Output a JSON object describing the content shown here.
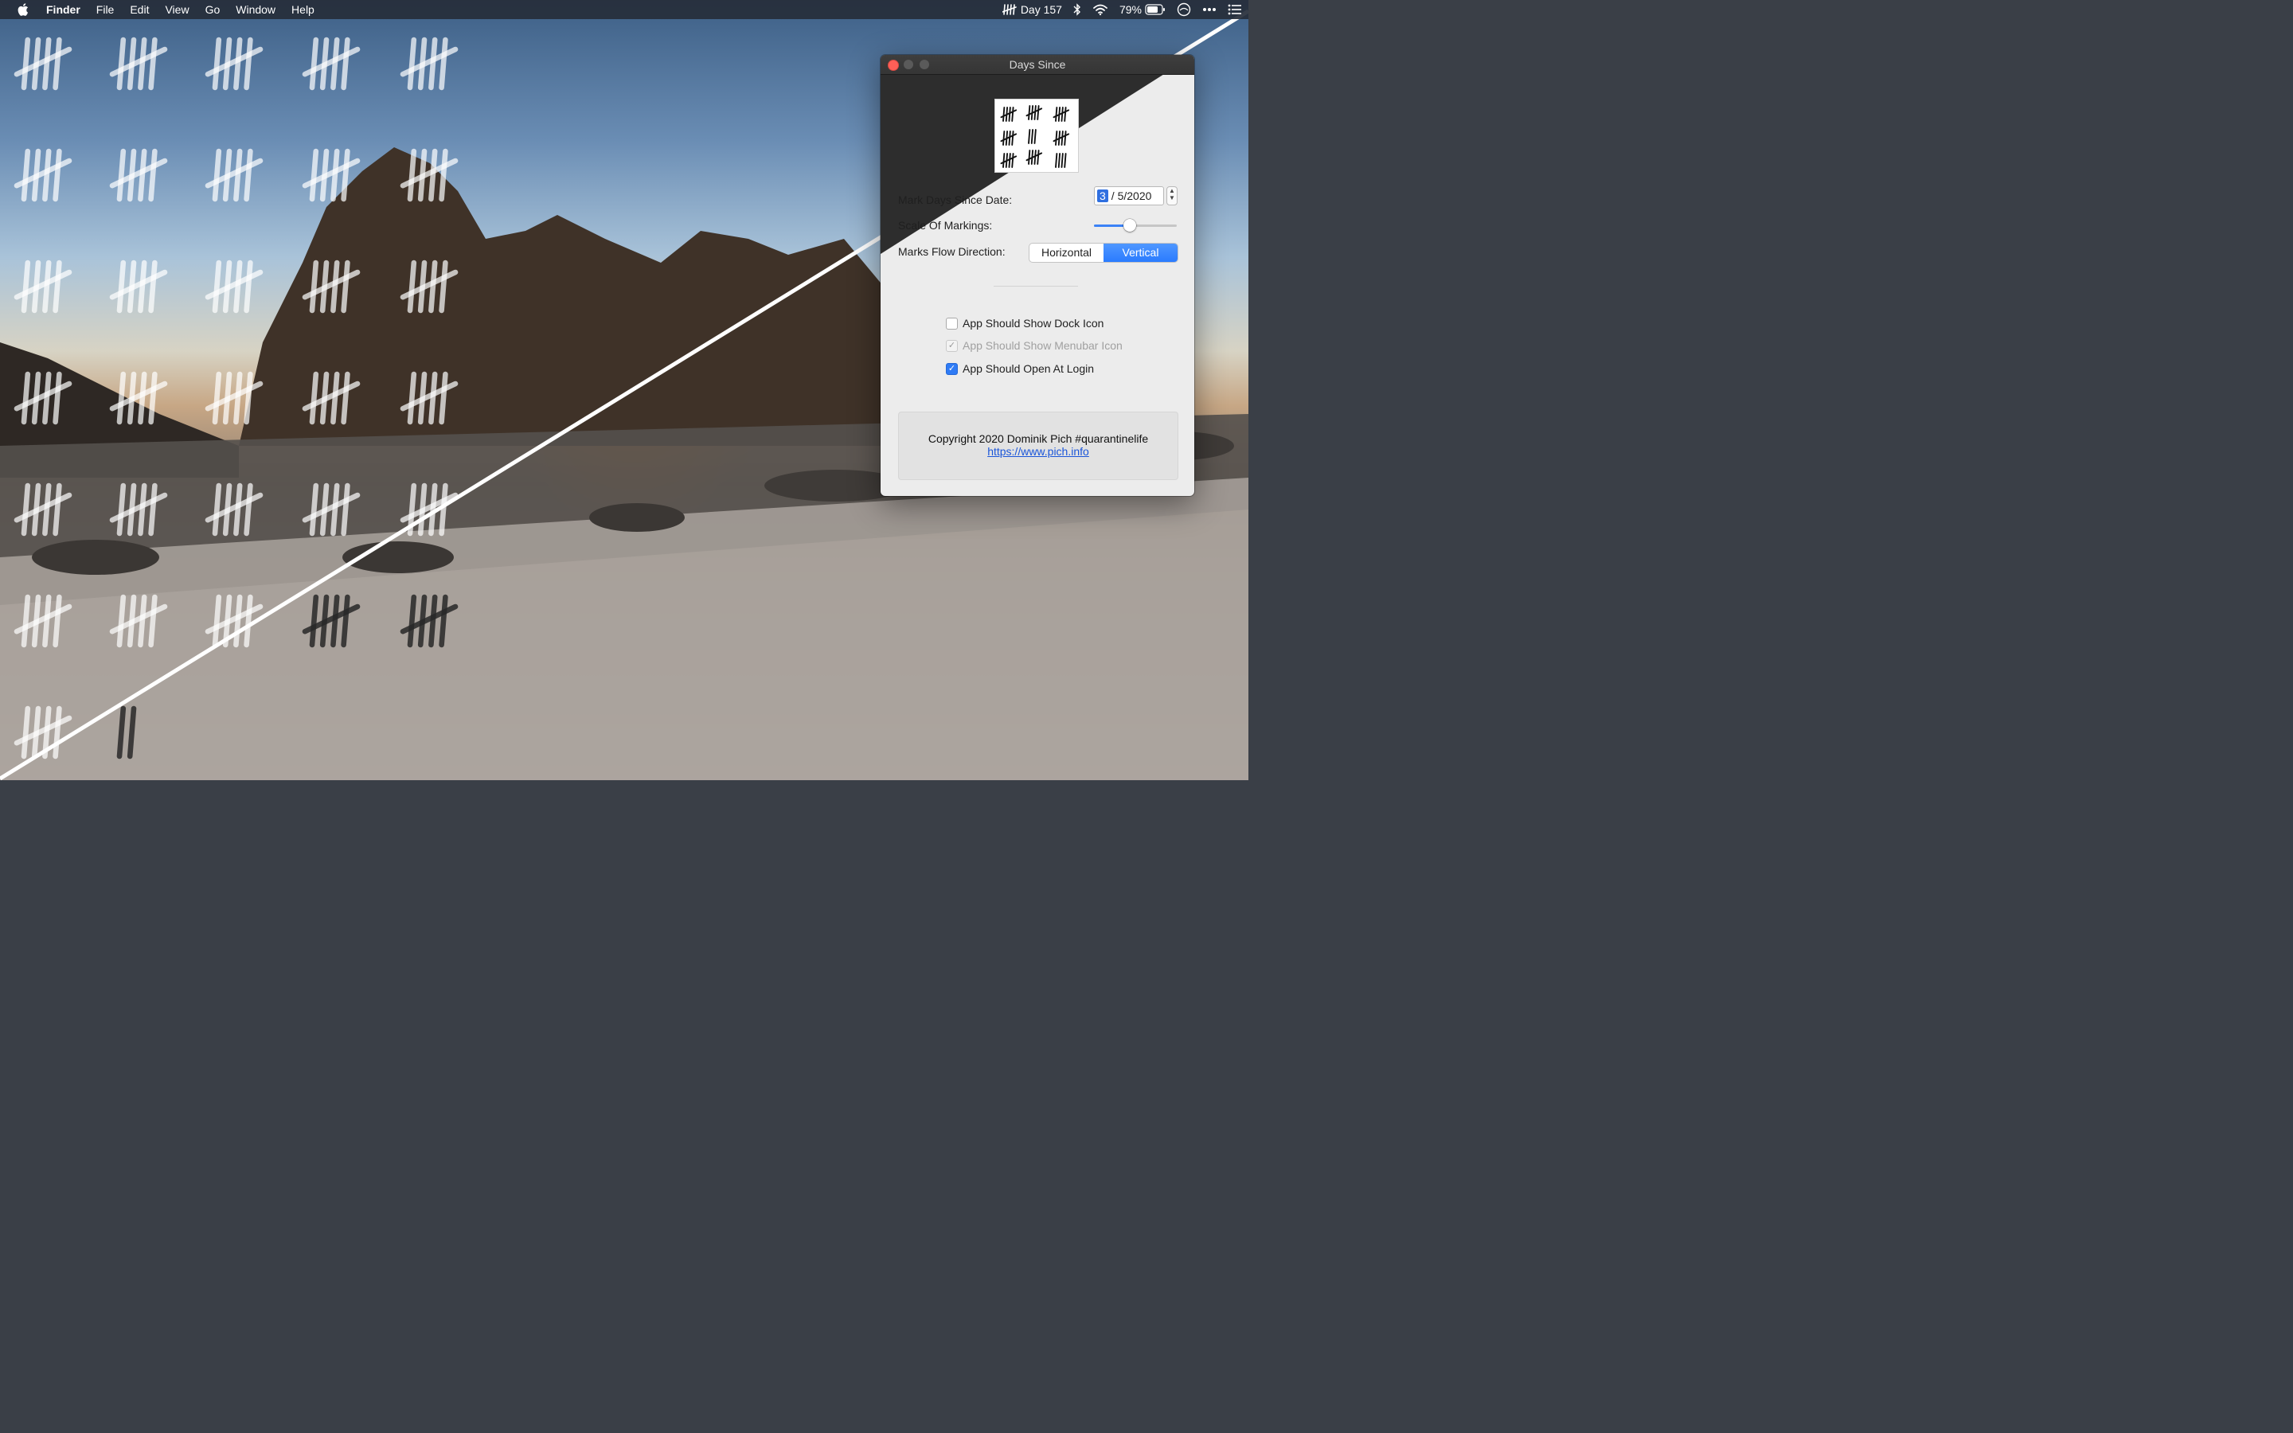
{
  "menubar": {
    "app_name": "Finder",
    "items": [
      "File",
      "Edit",
      "View",
      "Go",
      "Window",
      "Help"
    ],
    "status": {
      "day_counter": "Day 157",
      "battery": "79%"
    },
    "icons": [
      "apple-icon",
      "tally-icon",
      "bluetooth-icon",
      "wifi-icon",
      "battery-icon",
      "siri-icon",
      "control-center-icon",
      "notification-list-icon"
    ]
  },
  "window": {
    "title": "Days Since",
    "fields": {
      "date_label": "Mark Days Since Date:",
      "date_month": "3",
      "date_rest": "/ 5/2020",
      "scale_label": "Scale Of Markings:",
      "scale_value": 0.43,
      "flow_label": "Marks Flow Direction:",
      "flow_options": [
        "Horizontal",
        "Vertical"
      ],
      "flow_selected": "Vertical"
    },
    "checkboxes": [
      {
        "label": "App Should Show Dock Icon",
        "checked": false,
        "enabled": true
      },
      {
        "label": "App Should Show Menubar Icon",
        "checked": true,
        "enabled": false
      },
      {
        "label": "App Should Open At Login",
        "checked": true,
        "enabled": true
      }
    ],
    "footer": {
      "copyright": "Copyright 2020 Dominik Pich #quarantinelife",
      "link": "https://www.pich.info"
    }
  },
  "colors": {
    "accent": "#2f7bf5",
    "close_button": "#fe5f57",
    "menubar": "#262e3a"
  }
}
